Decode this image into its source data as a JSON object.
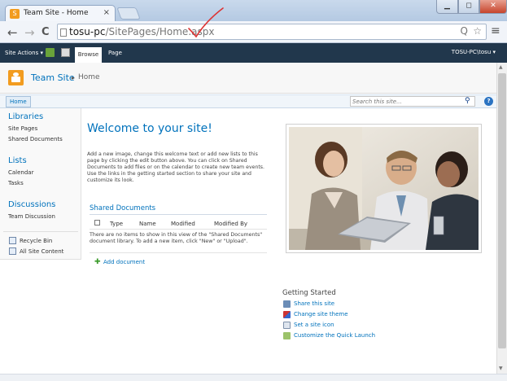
{
  "browser": {
    "tab_title": "Team Site - Home",
    "tab_close": "×",
    "url_host": "tosu-pc",
    "url_path": "/SitePages/Home.aspx",
    "back": "←",
    "forward": "→",
    "reload": "C",
    "menu": "≡",
    "star": "☆",
    "zoom": "Q"
  },
  "window_controls": {
    "minimize": "▁",
    "maximize": "◻",
    "close": "✕"
  },
  "ribbon": {
    "site_actions": "Site Actions ▾",
    "tabs": [
      {
        "label": "Browse"
      },
      {
        "label": "Page"
      }
    ],
    "user": "TOSU-PC\\tosu ▾"
  },
  "site": {
    "title": "Team Site",
    "breadcrumb_sep": "▸",
    "breadcrumb_current": "Home"
  },
  "topnav": {
    "home_tab": "Home",
    "search_placeholder": "Search this site...",
    "help": "?"
  },
  "quick_launch": {
    "libraries_heading": "Libraries",
    "libraries": [
      "Site Pages",
      "Shared Documents"
    ],
    "lists_heading": "Lists",
    "lists": [
      "Calendar",
      "Tasks"
    ],
    "discussions_heading": "Discussions",
    "discussions": [
      "Team Discussion"
    ],
    "recycle_bin": "Recycle Bin",
    "all_site_content": "All Site Content"
  },
  "main": {
    "welcome": "Welcome to your site!",
    "intro": "Add a new image, change this welcome text or add new lists to this page by clicking the edit button above. You can click on Shared Documents to add files or on the calendar to create new team events. Use the links in the getting started section to share your site and customize its look.",
    "shared_docs": {
      "title": "Shared Documents",
      "columns": [
        "Type",
        "Name",
        "Modified",
        "Modified By"
      ],
      "empty_message": "There are no items to show in this view of the \"Shared Documents\" document library. To add a new item, click \"New\" or \"Upload\".",
      "add_document": "Add document"
    }
  },
  "getting_started": {
    "title": "Getting Started",
    "items": [
      "Share this site",
      "Change site theme",
      "Set a site icon",
      "Customize the Quick Launch"
    ]
  },
  "colors": {
    "ribbon": "#21374c",
    "link": "#0072bc",
    "site_icon": "#f29c1f"
  }
}
